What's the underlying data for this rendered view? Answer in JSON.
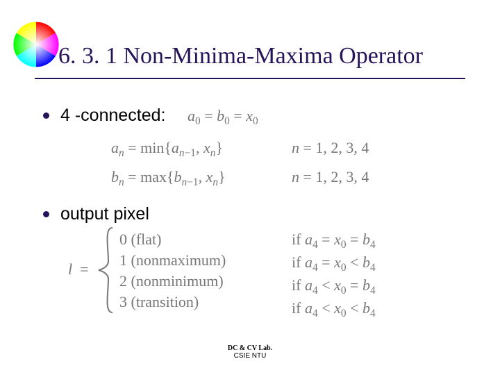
{
  "title": "6. 3. 1 Non-Minima-Maxima Operator",
  "bullets": {
    "b1": "4 -connected:",
    "b2": "output pixel"
  },
  "math": {
    "m1": "a₀ = b₀ = x₀",
    "m2a": "aₙ = min{aₙ₋₁, xₙ}",
    "m2b": "n = 1, 2, 3, 4",
    "m3a": "bₙ = max{bₙ₋₁, xₙ}",
    "m3b": "n = 1, 2, 3, 4",
    "l_eq": "l  =",
    "cases": [
      {
        "val": "0 (flat)",
        "cond": "if a₄ = x₀ = b₄"
      },
      {
        "val": "1 (nonmaximum)",
        "cond": "if a₄ = x₀ < b₄"
      },
      {
        "val": "2 (nonminimum)",
        "cond": "if a₄ < x₀ = b₄"
      },
      {
        "val": "3 (transition)",
        "cond": "if a₄ < x₀ < b₄"
      }
    ]
  },
  "footer": {
    "line1": "DC & CV Lab.",
    "line2": "CSIE NTU"
  },
  "colors": {
    "title": "#261458",
    "math": "#777777"
  }
}
